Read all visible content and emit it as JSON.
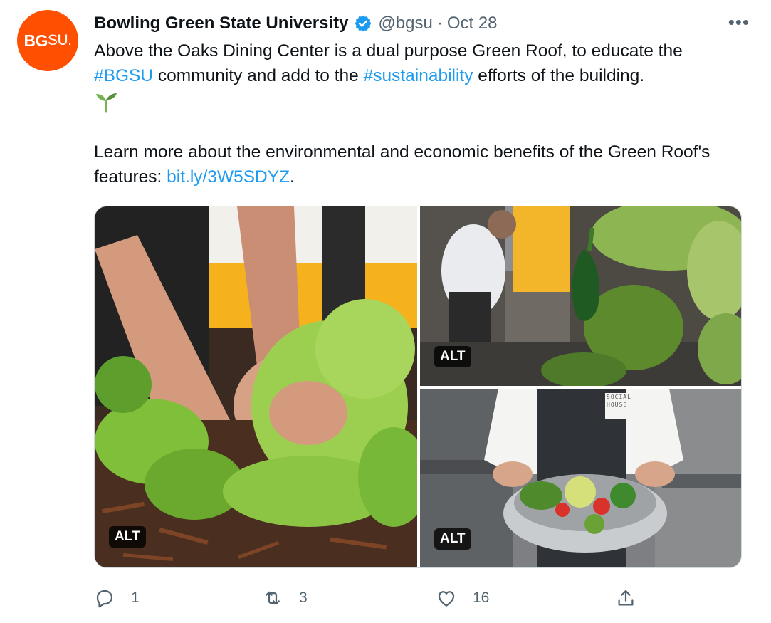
{
  "tweet": {
    "author": {
      "avatar_text_bold": "BG",
      "avatar_text_light": "SU.",
      "name": "Bowling Green State University",
      "handle": "@bgsu",
      "separator": "·",
      "date": "Oct 28"
    },
    "more_label": "•••",
    "text": {
      "line1": "Above the Oaks Dining Center is a dual purpose Green Roof, to educate the",
      "hashtag1": "#BGSU",
      "mid": " community and add to the ",
      "hashtag2": "#sustainability",
      "end": " efforts of the building.",
      "para2_part1": "Learn more about the environmental and economic benefits of the Green Roof's features: ",
      "link": "bit.ly/3W5SDYZ",
      "para2_end": "."
    },
    "media": {
      "alt_label": "ALT",
      "apron_text": "SOCIAL HOUSE"
    },
    "actions": {
      "replies": "1",
      "retweets": "3",
      "likes": "16"
    },
    "colors": {
      "brand_orange": "#fe5000",
      "link_blue": "#1d9bf0",
      "muted": "#536471"
    }
  }
}
